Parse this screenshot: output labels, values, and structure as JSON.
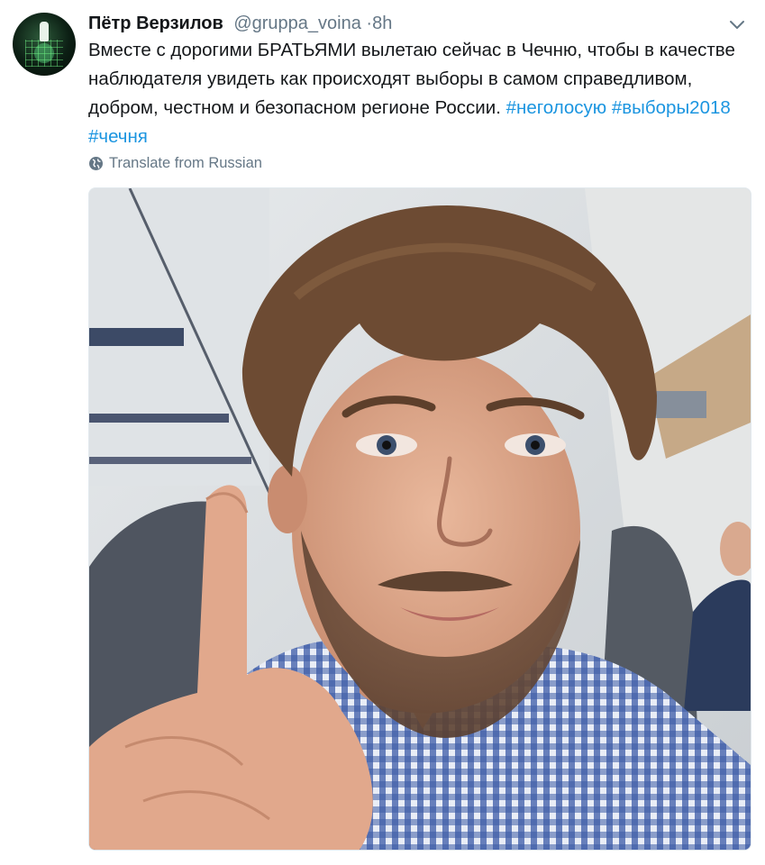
{
  "tweet": {
    "author_name": "Пётр Верзилов",
    "handle": "@gruppa_voina",
    "separator": "·",
    "time": "8h",
    "text_line": "Вместе с дорогими БРАТЬЯМИ вылетаю сейчас в Чечню, чтобы в качестве наблюдателя увидеть как происходят выборы в самом справедливом, добром, честном и безопасном регионе России.",
    "hashtags": [
      "#неголосую",
      "#выборы2018",
      "#чечня"
    ],
    "translate_label": "Translate from Russian"
  },
  "icons": {
    "avatar": "avatar",
    "caret": "chevron-down-icon",
    "globe": "globe-icon"
  },
  "colors": {
    "text": "#14171a",
    "secondary": "#657786",
    "link": "#1b95e0",
    "border": "#e1e8ed"
  },
  "photo": {
    "subject": "airplane selfie"
  }
}
